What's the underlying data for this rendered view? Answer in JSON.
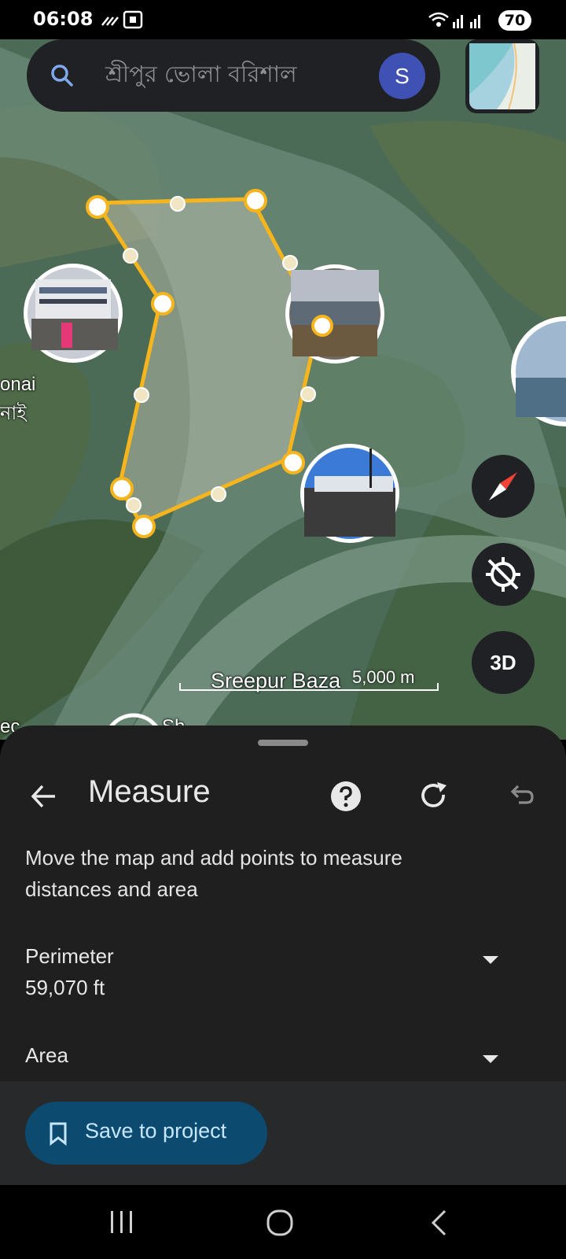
{
  "status_bar": {
    "time": "06:08",
    "battery": "70"
  },
  "search": {
    "query": "শ্রীপুর ভোলা বরিশাল",
    "avatar_letter": "S"
  },
  "map": {
    "place_labels": [
      "onai",
      "নাই",
      "Sreepur Baza",
      "ec",
      "Sh"
    ],
    "scale_label": "5,000 m",
    "btn_3d": "3D",
    "icons": [
      "search-icon",
      "compass-icon",
      "location-off-icon"
    ]
  },
  "sheet": {
    "title": "Measure",
    "description": "Move the map and add points to measure distances and area",
    "perimeter_label": "Perimeter",
    "perimeter_value": "59,070 ft",
    "area_label": "Area",
    "save_label": "Save to project",
    "icons": [
      "back-arrow-icon",
      "help-icon",
      "refresh-icon",
      "undo-icon",
      "chevron-down-icon",
      "bookmark-icon"
    ]
  },
  "colors": {
    "accent": "#fbc02d",
    "sheet_bg": "#1f1f1f",
    "save_button": "#0c4b6f"
  }
}
